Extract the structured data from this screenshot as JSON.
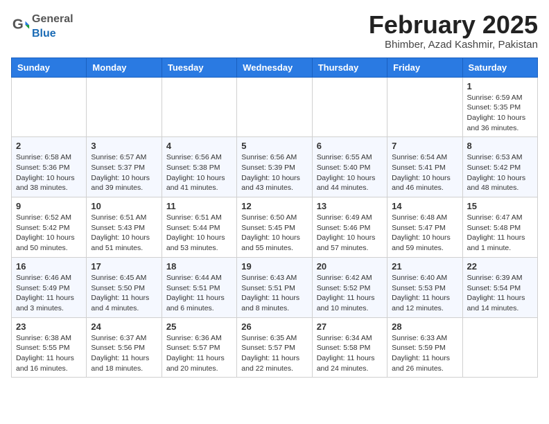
{
  "logo": {
    "general": "General",
    "blue": "Blue"
  },
  "title": "February 2025",
  "subtitle": "Bhimber, Azad Kashmir, Pakistan",
  "days_header": [
    "Sunday",
    "Monday",
    "Tuesday",
    "Wednesday",
    "Thursday",
    "Friday",
    "Saturday"
  ],
  "weeks": [
    [
      {
        "day": "",
        "info": ""
      },
      {
        "day": "",
        "info": ""
      },
      {
        "day": "",
        "info": ""
      },
      {
        "day": "",
        "info": ""
      },
      {
        "day": "",
        "info": ""
      },
      {
        "day": "",
        "info": ""
      },
      {
        "day": "1",
        "info": "Sunrise: 6:59 AM\nSunset: 5:35 PM\nDaylight: 10 hours and 36 minutes."
      }
    ],
    [
      {
        "day": "2",
        "info": "Sunrise: 6:58 AM\nSunset: 5:36 PM\nDaylight: 10 hours and 38 minutes."
      },
      {
        "day": "3",
        "info": "Sunrise: 6:57 AM\nSunset: 5:37 PM\nDaylight: 10 hours and 39 minutes."
      },
      {
        "day": "4",
        "info": "Sunrise: 6:56 AM\nSunset: 5:38 PM\nDaylight: 10 hours and 41 minutes."
      },
      {
        "day": "5",
        "info": "Sunrise: 6:56 AM\nSunset: 5:39 PM\nDaylight: 10 hours and 43 minutes."
      },
      {
        "day": "6",
        "info": "Sunrise: 6:55 AM\nSunset: 5:40 PM\nDaylight: 10 hours and 44 minutes."
      },
      {
        "day": "7",
        "info": "Sunrise: 6:54 AM\nSunset: 5:41 PM\nDaylight: 10 hours and 46 minutes."
      },
      {
        "day": "8",
        "info": "Sunrise: 6:53 AM\nSunset: 5:42 PM\nDaylight: 10 hours and 48 minutes."
      }
    ],
    [
      {
        "day": "9",
        "info": "Sunrise: 6:52 AM\nSunset: 5:42 PM\nDaylight: 10 hours and 50 minutes."
      },
      {
        "day": "10",
        "info": "Sunrise: 6:51 AM\nSunset: 5:43 PM\nDaylight: 10 hours and 51 minutes."
      },
      {
        "day": "11",
        "info": "Sunrise: 6:51 AM\nSunset: 5:44 PM\nDaylight: 10 hours and 53 minutes."
      },
      {
        "day": "12",
        "info": "Sunrise: 6:50 AM\nSunset: 5:45 PM\nDaylight: 10 hours and 55 minutes."
      },
      {
        "day": "13",
        "info": "Sunrise: 6:49 AM\nSunset: 5:46 PM\nDaylight: 10 hours and 57 minutes."
      },
      {
        "day": "14",
        "info": "Sunrise: 6:48 AM\nSunset: 5:47 PM\nDaylight: 10 hours and 59 minutes."
      },
      {
        "day": "15",
        "info": "Sunrise: 6:47 AM\nSunset: 5:48 PM\nDaylight: 11 hours and 1 minute."
      }
    ],
    [
      {
        "day": "16",
        "info": "Sunrise: 6:46 AM\nSunset: 5:49 PM\nDaylight: 11 hours and 3 minutes."
      },
      {
        "day": "17",
        "info": "Sunrise: 6:45 AM\nSunset: 5:50 PM\nDaylight: 11 hours and 4 minutes."
      },
      {
        "day": "18",
        "info": "Sunrise: 6:44 AM\nSunset: 5:51 PM\nDaylight: 11 hours and 6 minutes."
      },
      {
        "day": "19",
        "info": "Sunrise: 6:43 AM\nSunset: 5:51 PM\nDaylight: 11 hours and 8 minutes."
      },
      {
        "day": "20",
        "info": "Sunrise: 6:42 AM\nSunset: 5:52 PM\nDaylight: 11 hours and 10 minutes."
      },
      {
        "day": "21",
        "info": "Sunrise: 6:40 AM\nSunset: 5:53 PM\nDaylight: 11 hours and 12 minutes."
      },
      {
        "day": "22",
        "info": "Sunrise: 6:39 AM\nSunset: 5:54 PM\nDaylight: 11 hours and 14 minutes."
      }
    ],
    [
      {
        "day": "23",
        "info": "Sunrise: 6:38 AM\nSunset: 5:55 PM\nDaylight: 11 hours and 16 minutes."
      },
      {
        "day": "24",
        "info": "Sunrise: 6:37 AM\nSunset: 5:56 PM\nDaylight: 11 hours and 18 minutes."
      },
      {
        "day": "25",
        "info": "Sunrise: 6:36 AM\nSunset: 5:57 PM\nDaylight: 11 hours and 20 minutes."
      },
      {
        "day": "26",
        "info": "Sunrise: 6:35 AM\nSunset: 5:57 PM\nDaylight: 11 hours and 22 minutes."
      },
      {
        "day": "27",
        "info": "Sunrise: 6:34 AM\nSunset: 5:58 PM\nDaylight: 11 hours and 24 minutes."
      },
      {
        "day": "28",
        "info": "Sunrise: 6:33 AM\nSunset: 5:59 PM\nDaylight: 11 hours and 26 minutes."
      },
      {
        "day": "",
        "info": ""
      }
    ]
  ]
}
